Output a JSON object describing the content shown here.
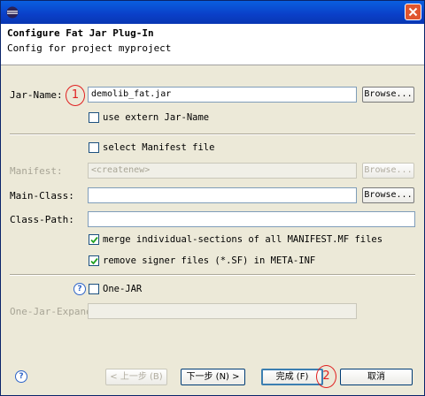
{
  "header": {
    "title": "Configure Fat Jar Plug-In",
    "description": "Config for project myproject"
  },
  "jar": {
    "label": "Jar-Name:",
    "value": "demolib_fat.jar",
    "browse": "Browse...",
    "use_extern_label": "use extern Jar-Name",
    "use_extern_checked": false
  },
  "manifest": {
    "select_label": "select Manifest file",
    "select_checked": false,
    "label": "Manifest:",
    "value": "<createnew>",
    "browse": "Browse..."
  },
  "main_class": {
    "label": "Main-Class:",
    "value": "",
    "browse": "Browse..."
  },
  "class_path": {
    "label": "Class-Path:",
    "value": ""
  },
  "options": {
    "merge_label": "merge individual-sections of all MANIFEST.MF files",
    "merge_checked": true,
    "remove_label": "remove signer files (*.SF) in META-INF",
    "remove_checked": true
  },
  "one_jar": {
    "label": "One-JAR",
    "checked": false,
    "expand_label": "One-Jar-Expand:",
    "expand_value": ""
  },
  "annotations": {
    "first": "1",
    "second": "2"
  },
  "buttons": {
    "back": "< 上一步 (B)",
    "next": "下一步 (N) >",
    "finish": "完成 (F)",
    "cancel": "取消"
  },
  "colors": {
    "title_bar": "#0a4fd6",
    "close": "#e0552e",
    "annotation": "#e02020",
    "dialog_bg": "#ece9d8"
  },
  "icons": {
    "app": "eclipse-icon",
    "close": "close-icon",
    "help": "help-icon",
    "check": "checkmark-icon"
  }
}
